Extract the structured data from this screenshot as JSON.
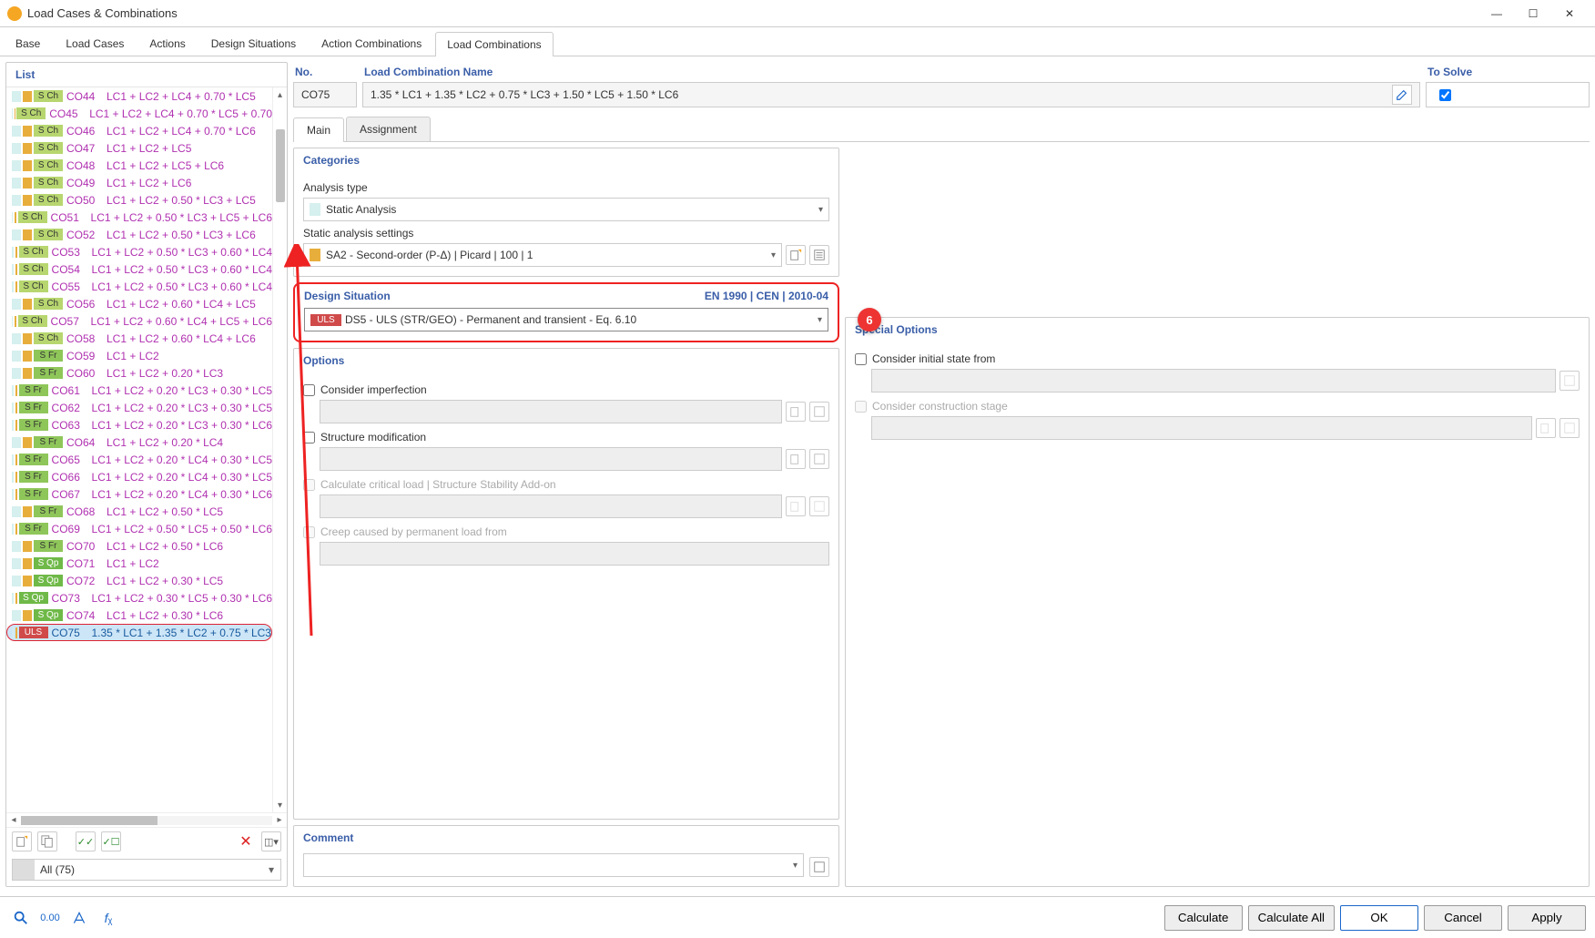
{
  "window": {
    "title": "Load Cases & Combinations"
  },
  "winbuttons": {
    "min": "—",
    "max": "☐",
    "close": "✕"
  },
  "tabs": [
    "Base",
    "Load Cases",
    "Actions",
    "Design Situations",
    "Action Combinations",
    "Load Combinations"
  ],
  "tabs_active": 5,
  "list_header": "List",
  "list": [
    {
      "badge": "S Ch",
      "bcl": "b-sch",
      "code": "CO44",
      "desc": "LC1 + LC2 + LC4 + 0.70 * LC5"
    },
    {
      "badge": "S Ch",
      "bcl": "b-sch",
      "code": "CO45",
      "desc": "LC1 + LC2 + LC4 + 0.70 * LC5 + 0.70"
    },
    {
      "badge": "S Ch",
      "bcl": "b-sch",
      "code": "CO46",
      "desc": "LC1 + LC2 + LC4 + 0.70 * LC6"
    },
    {
      "badge": "S Ch",
      "bcl": "b-sch",
      "code": "CO47",
      "desc": "LC1 + LC2 + LC5"
    },
    {
      "badge": "S Ch",
      "bcl": "b-sch",
      "code": "CO48",
      "desc": "LC1 + LC2 + LC5 + LC6"
    },
    {
      "badge": "S Ch",
      "bcl": "b-sch",
      "code": "CO49",
      "desc": "LC1 + LC2 + LC6"
    },
    {
      "badge": "S Ch",
      "bcl": "b-sch",
      "code": "CO50",
      "desc": "LC1 + LC2 + 0.50 * LC3 + LC5"
    },
    {
      "badge": "S Ch",
      "bcl": "b-sch",
      "code": "CO51",
      "desc": "LC1 + LC2 + 0.50 * LC3 + LC5 + LC6"
    },
    {
      "badge": "S Ch",
      "bcl": "b-sch",
      "code": "CO52",
      "desc": "LC1 + LC2 + 0.50 * LC3 + LC6"
    },
    {
      "badge": "S Ch",
      "bcl": "b-sch",
      "code": "CO53",
      "desc": "LC1 + LC2 + 0.50 * LC3 + 0.60 * LC4"
    },
    {
      "badge": "S Ch",
      "bcl": "b-sch",
      "code": "CO54",
      "desc": "LC1 + LC2 + 0.50 * LC3 + 0.60 * LC4"
    },
    {
      "badge": "S Ch",
      "bcl": "b-sch",
      "code": "CO55",
      "desc": "LC1 + LC2 + 0.50 * LC3 + 0.60 * LC4"
    },
    {
      "badge": "S Ch",
      "bcl": "b-sch",
      "code": "CO56",
      "desc": "LC1 + LC2 + 0.60 * LC4 + LC5"
    },
    {
      "badge": "S Ch",
      "bcl": "b-sch",
      "code": "CO57",
      "desc": "LC1 + LC2 + 0.60 * LC4 + LC5 + LC6"
    },
    {
      "badge": "S Ch",
      "bcl": "b-sch",
      "code": "CO58",
      "desc": "LC1 + LC2 + 0.60 * LC4 + LC6"
    },
    {
      "badge": "S Fr",
      "bcl": "b-sfr",
      "code": "CO59",
      "desc": "LC1 + LC2"
    },
    {
      "badge": "S Fr",
      "bcl": "b-sfr",
      "code": "CO60",
      "desc": "LC1 + LC2 + 0.20 * LC3"
    },
    {
      "badge": "S Fr",
      "bcl": "b-sfr",
      "code": "CO61",
      "desc": "LC1 + LC2 + 0.20 * LC3 + 0.30 * LC5"
    },
    {
      "badge": "S Fr",
      "bcl": "b-sfr",
      "code": "CO62",
      "desc": "LC1 + LC2 + 0.20 * LC3 + 0.30 * LC5"
    },
    {
      "badge": "S Fr",
      "bcl": "b-sfr",
      "code": "CO63",
      "desc": "LC1 + LC2 + 0.20 * LC3 + 0.30 * LC6"
    },
    {
      "badge": "S Fr",
      "bcl": "b-sfr",
      "code": "CO64",
      "desc": "LC1 + LC2 + 0.20 * LC4"
    },
    {
      "badge": "S Fr",
      "bcl": "b-sfr",
      "code": "CO65",
      "desc": "LC1 + LC2 + 0.20 * LC4 + 0.30 * LC5"
    },
    {
      "badge": "S Fr",
      "bcl": "b-sfr",
      "code": "CO66",
      "desc": "LC1 + LC2 + 0.20 * LC4 + 0.30 * LC5"
    },
    {
      "badge": "S Fr",
      "bcl": "b-sfr",
      "code": "CO67",
      "desc": "LC1 + LC2 + 0.20 * LC4 + 0.30 * LC6"
    },
    {
      "badge": "S Fr",
      "bcl": "b-sfr",
      "code": "CO68",
      "desc": "LC1 + LC2 + 0.50 * LC5"
    },
    {
      "badge": "S Fr",
      "bcl": "b-sfr",
      "code": "CO69",
      "desc": "LC1 + LC2 + 0.50 * LC5 + 0.50 * LC6"
    },
    {
      "badge": "S Fr",
      "bcl": "b-sfr",
      "code": "CO70",
      "desc": "LC1 + LC2 + 0.50 * LC6"
    },
    {
      "badge": "S Qp",
      "bcl": "b-sqp",
      "code": "CO71",
      "desc": "LC1 + LC2"
    },
    {
      "badge": "S Qp",
      "bcl": "b-sqp",
      "code": "CO72",
      "desc": "LC1 + LC2 + 0.30 * LC5"
    },
    {
      "badge": "S Qp",
      "bcl": "b-sqp",
      "code": "CO73",
      "desc": "LC1 + LC2 + 0.30 * LC5 + 0.30 * LC6"
    },
    {
      "badge": "S Qp",
      "bcl": "b-sqp",
      "code": "CO74",
      "desc": "LC1 + LC2 + 0.30 * LC6"
    },
    {
      "badge": "ULS",
      "bcl": "b-uls",
      "code": "CO75",
      "desc": "1.35 * LC1 + 1.35 * LC2 + 0.75 * LC3",
      "selected": true
    }
  ],
  "filter": {
    "text": "All (75)"
  },
  "no": {
    "header": "No.",
    "value": "CO75"
  },
  "name": {
    "header": "Load Combination Name",
    "value": "1.35 * LC1 + 1.35 * LC2 + 0.75 * LC3 + 1.50 * LC5 + 1.50 * LC6"
  },
  "solve": {
    "header": "To Solve",
    "checked": true
  },
  "subtabs": [
    "Main",
    "Assignment"
  ],
  "subtabs_active": 0,
  "categories": {
    "header": "Categories",
    "analysis_type_lbl": "Analysis type",
    "analysis_type": "Static Analysis",
    "settings_lbl": "Static analysis settings",
    "settings": "SA2 - Second-order (P-Δ) | Picard | 100 | 1"
  },
  "design_situation": {
    "header": "Design Situation",
    "standard": "EN 1990 | CEN | 2010-04",
    "value": "DS5 - ULS (STR/GEO) - Permanent and transient - Eq. 6.10",
    "badge": "ULS",
    "callout": "6"
  },
  "options": {
    "header": "Options",
    "o1": "Consider imperfection",
    "o2": "Structure modification",
    "o3": "Calculate critical load | Structure Stability Add-on",
    "o4": "Creep caused by permanent load from"
  },
  "special": {
    "header": "Special Options",
    "s1": "Consider initial state from",
    "s2": "Consider construction stage"
  },
  "comment": {
    "header": "Comment"
  },
  "footer": {
    "calc": "Calculate",
    "calc_all": "Calculate All",
    "ok": "OK",
    "cancel": "Cancel",
    "apply": "Apply"
  }
}
